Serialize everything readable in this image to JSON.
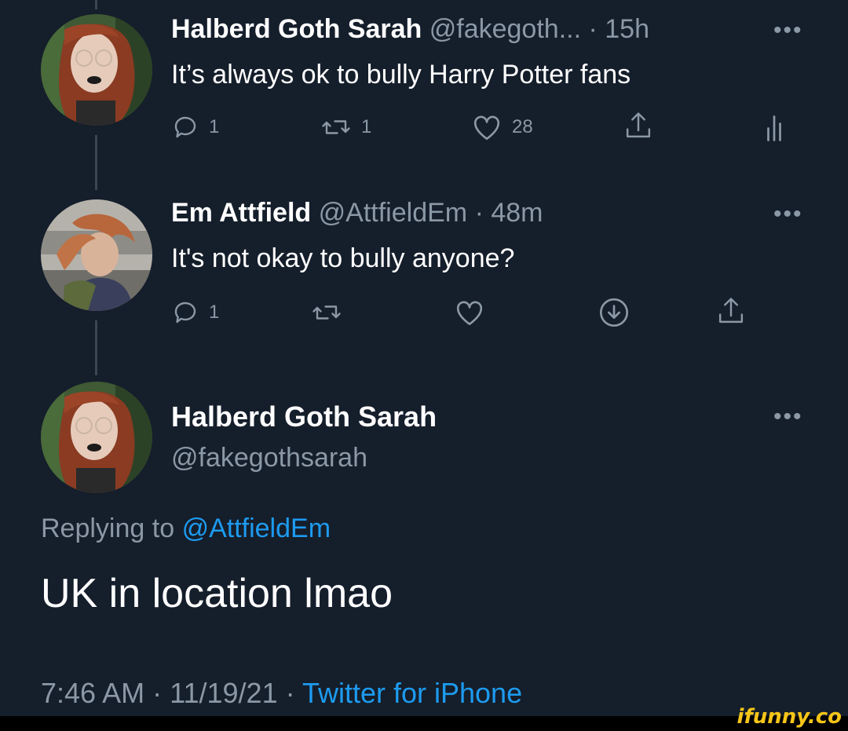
{
  "tweets": [
    {
      "name": "Halberd Goth Sarah",
      "handle": "@fakegoth...",
      "time": "· 15h",
      "more": "•••",
      "text": "It’s always ok to bully Harry Potter fans",
      "reply_count": "1",
      "retweet_count": "1",
      "like_count": "28"
    },
    {
      "name": "Em Attfield",
      "handle": "@AttfieldEm",
      "time": "· 48m",
      "more": "•••",
      "text": "It's not okay to bully anyone?",
      "reply_count": "1"
    }
  ],
  "main_tweet": {
    "name": "Halberd Goth Sarah",
    "handle": "@fakegothsarah",
    "more": "•••",
    "replying_prefix": "Replying to",
    "replying_to": "@AttfieldEm",
    "text": "UK in location lmao",
    "time": "7:46 AM",
    "date": "11/19/21",
    "separator": "·",
    "source": "Twitter for iPhone"
  },
  "watermark": "ifunny.co",
  "icons": {
    "reply": "reply-icon",
    "retweet": "retweet-icon",
    "like": "heart-icon",
    "share": "share-icon",
    "analytics": "analytics-icon",
    "download": "download-icon"
  },
  "colors": {
    "background": "#151e2b",
    "muted": "#8b98a5",
    "link": "#1d9bf0",
    "watermark": "#f5c518"
  }
}
